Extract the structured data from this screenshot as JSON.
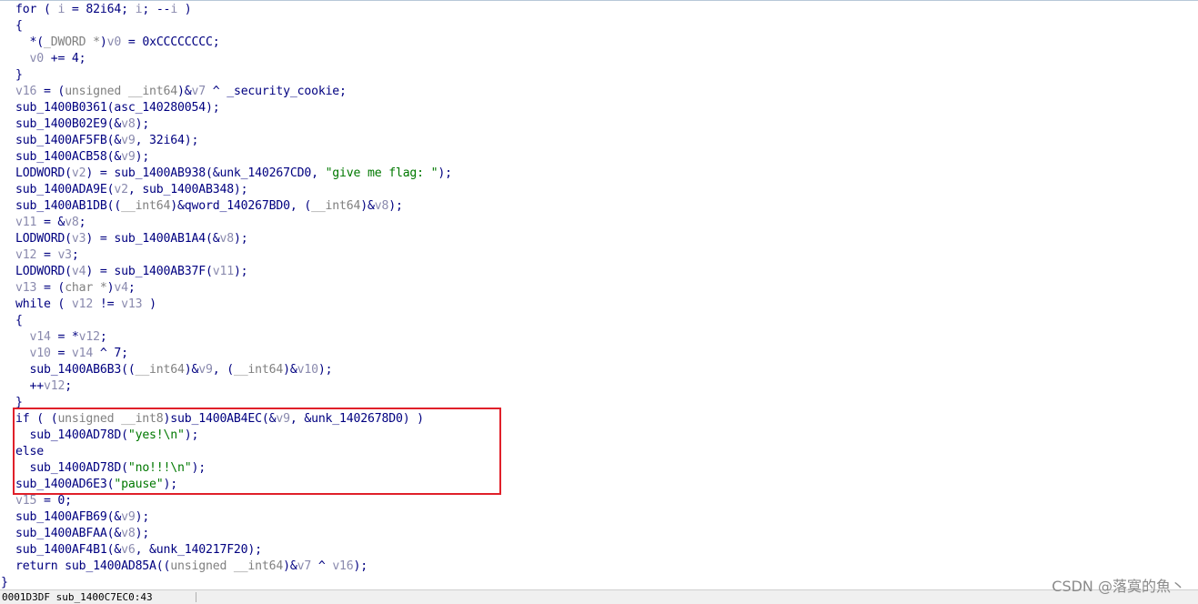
{
  "colors": {
    "identifier": "#000080",
    "variable": "#8a8aae",
    "type": "#808080",
    "string": "#007800",
    "highlight_border": "#e0202a"
  },
  "code_lines": [
    [
      [
        "i",
        "for ( "
      ],
      [
        "v",
        "i"
      ],
      [
        "i",
        " = 82i64; "
      ],
      [
        "v",
        "i"
      ],
      [
        "i",
        "; --"
      ],
      [
        "v",
        "i"
      ],
      [
        "i",
        " )"
      ]
    ],
    [
      [
        "i",
        "{"
      ]
    ],
    [
      [
        "i",
        "  *("
      ],
      [
        "t",
        "_DWORD *"
      ],
      [
        "i",
        ")"
      ],
      [
        "v",
        "v0"
      ],
      [
        "i",
        " = 0xCCCCCCCC;"
      ]
    ],
    [
      [
        "i",
        "  "
      ],
      [
        "v",
        "v0"
      ],
      [
        "i",
        " += 4;"
      ]
    ],
    [
      [
        "i",
        "}"
      ]
    ],
    [
      [
        "v",
        "v16"
      ],
      [
        "i",
        " = ("
      ],
      [
        "t",
        "unsigned __int64"
      ],
      [
        "i",
        ")&"
      ],
      [
        "v",
        "v7"
      ],
      [
        "i",
        " ^ _security_cookie;"
      ]
    ],
    [
      [
        "i",
        "sub_1400B0361(asc_140280054);"
      ]
    ],
    [
      [
        "i",
        "sub_1400B02E9(&"
      ],
      [
        "v",
        "v8"
      ],
      [
        "i",
        ");"
      ]
    ],
    [
      [
        "i",
        "sub_1400AF5FB(&"
      ],
      [
        "v",
        "v9"
      ],
      [
        "i",
        ", 32i64);"
      ]
    ],
    [
      [
        "i",
        "sub_1400ACB58(&"
      ],
      [
        "v",
        "v9"
      ],
      [
        "i",
        ");"
      ]
    ],
    [
      [
        "i",
        "LODWORD("
      ],
      [
        "v",
        "v2"
      ],
      [
        "i",
        ") = sub_1400AB938(&unk_140267CD0, "
      ],
      [
        "s",
        "\"give me flag: \""
      ],
      [
        "i",
        ");"
      ]
    ],
    [
      [
        "i",
        "sub_1400ADA9E("
      ],
      [
        "v",
        "v2"
      ],
      [
        "i",
        ", sub_1400AB348);"
      ]
    ],
    [
      [
        "i",
        "sub_1400AB1DB(("
      ],
      [
        "t",
        "__int64"
      ],
      [
        "i",
        ")&qword_140267BD0, ("
      ],
      [
        "t",
        "__int64"
      ],
      [
        "i",
        ")&"
      ],
      [
        "v",
        "v8"
      ],
      [
        "i",
        ");"
      ]
    ],
    [
      [
        "v",
        "v11"
      ],
      [
        "i",
        " = &"
      ],
      [
        "v",
        "v8"
      ],
      [
        "i",
        ";"
      ]
    ],
    [
      [
        "i",
        "LODWORD("
      ],
      [
        "v",
        "v3"
      ],
      [
        "i",
        ") = sub_1400AB1A4(&"
      ],
      [
        "v",
        "v8"
      ],
      [
        "i",
        ");"
      ]
    ],
    [
      [
        "v",
        "v12"
      ],
      [
        "i",
        " = "
      ],
      [
        "v",
        "v3"
      ],
      [
        "i",
        ";"
      ]
    ],
    [
      [
        "i",
        "LODWORD("
      ],
      [
        "v",
        "v4"
      ],
      [
        "i",
        ") = sub_1400AB37F("
      ],
      [
        "v",
        "v11"
      ],
      [
        "i",
        ");"
      ]
    ],
    [
      [
        "v",
        "v13"
      ],
      [
        "i",
        " = ("
      ],
      [
        "t",
        "char *"
      ],
      [
        "i",
        ")"
      ],
      [
        "v",
        "v4"
      ],
      [
        "i",
        ";"
      ]
    ],
    [
      [
        "i",
        "while ( "
      ],
      [
        "v",
        "v12"
      ],
      [
        "i",
        " != "
      ],
      [
        "v",
        "v13"
      ],
      [
        "i",
        " )"
      ]
    ],
    [
      [
        "i",
        "{"
      ]
    ],
    [
      [
        "i",
        "  "
      ],
      [
        "v",
        "v14"
      ],
      [
        "i",
        " = *"
      ],
      [
        "v",
        "v12"
      ],
      [
        "i",
        ";"
      ]
    ],
    [
      [
        "i",
        "  "
      ],
      [
        "v",
        "v10"
      ],
      [
        "i",
        " = "
      ],
      [
        "v",
        "v14"
      ],
      [
        "i",
        " ^ 7;"
      ]
    ],
    [
      [
        "i",
        "  sub_1400AB6B3(("
      ],
      [
        "t",
        "__int64"
      ],
      [
        "i",
        ")&"
      ],
      [
        "v",
        "v9"
      ],
      [
        "i",
        ", ("
      ],
      [
        "t",
        "__int64"
      ],
      [
        "i",
        ")&"
      ],
      [
        "v",
        "v10"
      ],
      [
        "i",
        ");"
      ]
    ],
    [
      [
        "i",
        "  ++"
      ],
      [
        "v",
        "v12"
      ],
      [
        "i",
        ";"
      ]
    ],
    [
      [
        "i",
        "}"
      ]
    ],
    [
      [
        "i",
        "if ( ("
      ],
      [
        "t",
        "unsigned __int8"
      ],
      [
        "i",
        ")sub_1400AB4EC(&"
      ],
      [
        "v",
        "v9"
      ],
      [
        "i",
        ", &unk_1402678D0) )"
      ]
    ],
    [
      [
        "i",
        "  sub_1400AD78D("
      ],
      [
        "s",
        "\"yes!\\n\""
      ],
      [
        "i",
        ");"
      ]
    ],
    [
      [
        "i",
        "else"
      ]
    ],
    [
      [
        "i",
        "  sub_1400AD78D("
      ],
      [
        "s",
        "\"no!!!\\n\""
      ],
      [
        "i",
        ");"
      ]
    ],
    [
      [
        "i",
        "sub_1400AD6E3("
      ],
      [
        "s",
        "\"pause\""
      ],
      [
        "i",
        ");"
      ]
    ],
    [
      [
        "v",
        "v15"
      ],
      [
        "i",
        " = 0;"
      ]
    ],
    [
      [
        "i",
        "sub_1400AFB69(&"
      ],
      [
        "v",
        "v9"
      ],
      [
        "i",
        ");"
      ]
    ],
    [
      [
        "i",
        "sub_1400ABFAA(&"
      ],
      [
        "v",
        "v8"
      ],
      [
        "i",
        ");"
      ]
    ],
    [
      [
        "i",
        "sub_1400AF4B1(&"
      ],
      [
        "v",
        "v6"
      ],
      [
        "i",
        ", &unk_140217F20);"
      ]
    ],
    [
      [
        "i",
        "return sub_1400AD85A(("
      ],
      [
        "t",
        "unsigned __int64"
      ],
      [
        "i",
        ")&"
      ],
      [
        "v",
        "v7"
      ],
      [
        "i",
        " ^ "
      ],
      [
        "v",
        "v16"
      ],
      [
        "i",
        ");"
      ]
    ],
    [
      [
        "i",
        "}"
      ]
    ]
  ],
  "status_bar": {
    "address": "0001D3DF sub_1400C7EC0:43"
  },
  "watermark": {
    "text": "CSDN @落寞的魚丶"
  }
}
